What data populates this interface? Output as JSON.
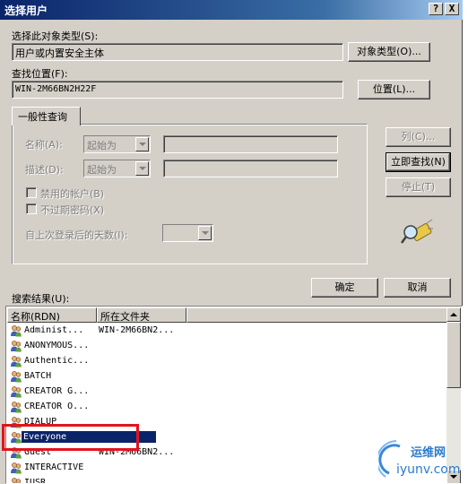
{
  "window": {
    "title": "选择用户",
    "help_btn": "?",
    "close_btn": "X"
  },
  "object_type": {
    "label": "选择此对象类型(S):",
    "value": "用户或内置安全主体",
    "button": "对象类型(O)..."
  },
  "location": {
    "label": "查找位置(F):",
    "value": "WIN-2M66BN2H22F",
    "button": "位置(L)..."
  },
  "general_query": {
    "tab_label": "一般性查询",
    "name_label": "名称(A):",
    "name_combo": "起始为",
    "desc_label": "描述(D):",
    "desc_combo": "起始为",
    "disabled_accounts": "禁用的帐户(B)",
    "non_expiring_pw": "不过期密码(X)",
    "days_since_logon": "自上次登录后的天数(I):"
  },
  "side_buttons": {
    "columns": "列(C)...",
    "find_now": "立即查找(N)",
    "stop": "停止(T)"
  },
  "actions": {
    "ok": "确定",
    "cancel": "取消"
  },
  "results": {
    "label": "搜索结果(U):",
    "col_name": "名称(RDN)",
    "col_folder": "所在文件夹",
    "rows": [
      {
        "name": "Administ...",
        "folder": "WIN-2M66BN2..."
      },
      {
        "name": "ANONYMOUS...",
        "folder": ""
      },
      {
        "name": "Authentic...",
        "folder": ""
      },
      {
        "name": "BATCH",
        "folder": ""
      },
      {
        "name": "CREATOR G...",
        "folder": ""
      },
      {
        "name": "CREATOR O...",
        "folder": ""
      },
      {
        "name": "DIALUP",
        "folder": ""
      },
      {
        "name": "Everyone",
        "folder": ""
      },
      {
        "name": "Guest",
        "folder": "WIN-2M66BN2..."
      },
      {
        "name": "INTERACTIVE",
        "folder": ""
      },
      {
        "name": "IUSR",
        "folder": ""
      }
    ],
    "selected_index": 7
  },
  "watermark": {
    "line1": "运维网",
    "line2": "iyunv.com"
  }
}
